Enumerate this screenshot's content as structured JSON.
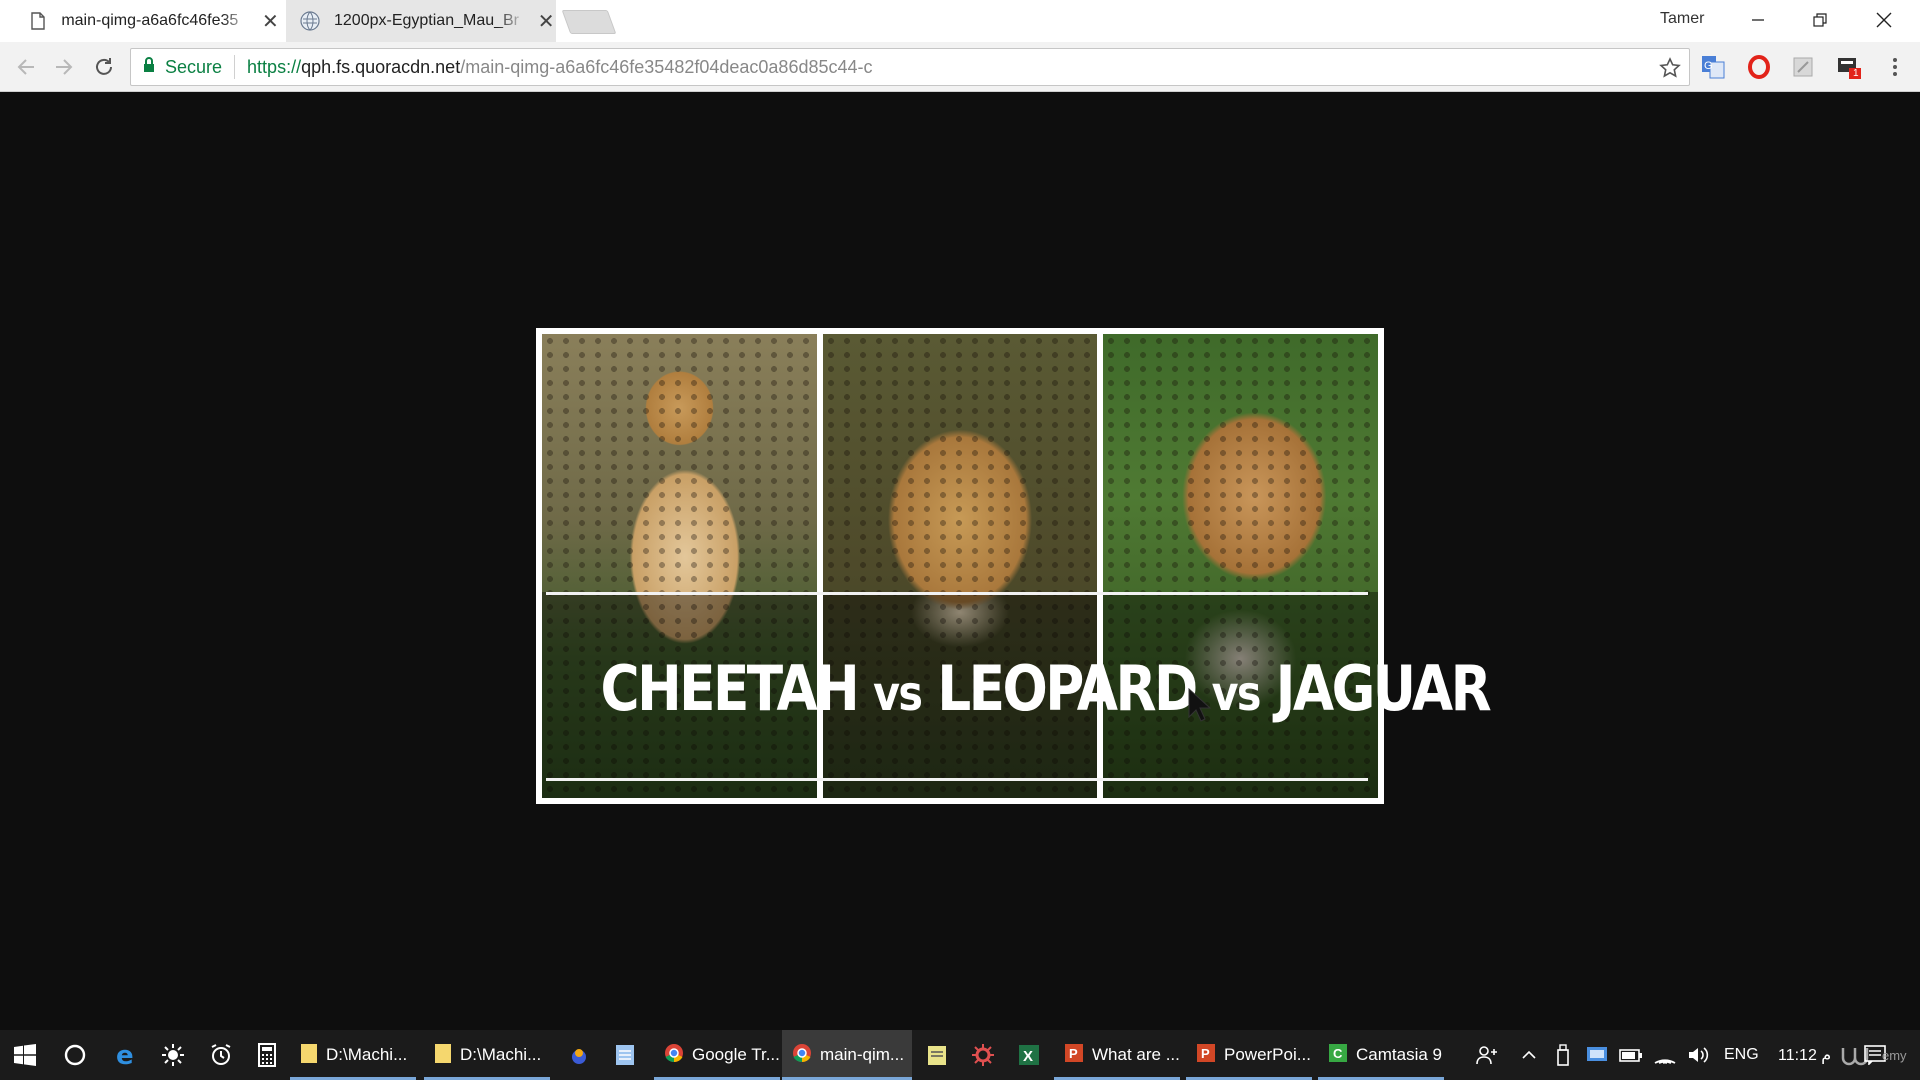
{
  "browser": {
    "tabs": [
      {
        "title": "main-qimg-a6a6fc46fe35",
        "icon": "document-icon",
        "active": true
      },
      {
        "title": "1200px-Egyptian_Mau_Br",
        "icon": "wikipedia-icon",
        "active": false
      }
    ],
    "profile_name": "Tamer",
    "security_label": "Secure",
    "url": {
      "scheme": "https://",
      "host": "qph.fs.quoracdn.net",
      "path": "/main-qimg-a6a6fc46fe35482f04deac0a86d85c44-c"
    },
    "extension_badge": "1"
  },
  "content": {
    "image_caption": {
      "part1": "CHEETAH",
      "vs1": "vs",
      "part2": "LEOPARD",
      "vs2": "vs",
      "part3": "JAGUAR"
    },
    "panels": [
      "cheetah",
      "leopard",
      "jaguar"
    ]
  },
  "taskbar": {
    "apps": [
      {
        "label": "D:\\Machi...",
        "icon": "folder-icon"
      },
      {
        "label": "D:\\Machi...",
        "icon": "folder-icon"
      },
      {
        "label": "Google Tr...",
        "icon": "chrome-icon"
      },
      {
        "label": "main-qim...",
        "icon": "chrome-icon"
      },
      {
        "label": "What are ...",
        "icon": "powerpoint-icon"
      },
      {
        "label": "PowerPoi...",
        "icon": "powerpoint-icon"
      },
      {
        "label": "Camtasia 9",
        "icon": "camtasia-icon"
      }
    ],
    "language": "ENG",
    "time": "11:12 م",
    "watermark": "emy"
  },
  "colors": {
    "secure_green": "#0b8043",
    "page_background": "#0e0e0e",
    "taskbar_background": "#1b1b1b"
  }
}
